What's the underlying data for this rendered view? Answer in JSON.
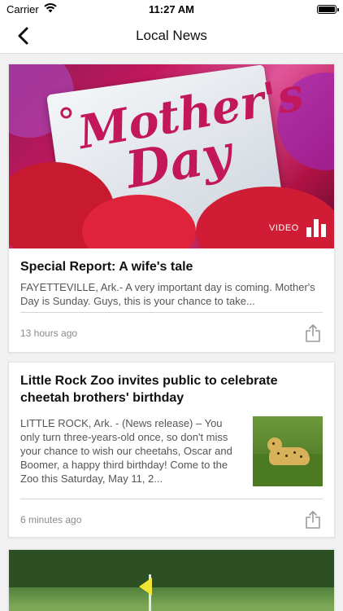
{
  "status_bar": {
    "carrier": "Carrier",
    "time": "11:27 AM",
    "battery_level": 1.0
  },
  "nav": {
    "title": "Local News",
    "back_icon": "chevron-left-icon"
  },
  "articles": [
    {
      "title": "Special Report: A wife's tale",
      "description": "FAYETTEVILLE, Ark.- A very important day is coming. Mother's Day is Sunday. Guys, this is your chance to take...",
      "time": "13 hours ago",
      "media_label": "VIDEO",
      "hero_text_line1": "Mother's",
      "hero_text_line2": "Day",
      "share_icon": "share-icon"
    },
    {
      "title": "Little Rock Zoo invites public to celebrate cheetah brothers' birthday",
      "description": "LITTLE ROCK, Ark. - (News release) – You only turn three-years-old once, so don't miss your chance to wish our cheetahs, Oscar and Boomer, a happy third birthday! Come to the Zoo this Saturday, May 11, 2...",
      "time": "6 minutes ago",
      "thumbnail": "cheetah-photo",
      "share_icon": "share-icon"
    },
    {
      "thumbnail": "golf-course-photo"
    }
  ],
  "colors": {
    "accent": "#c2185b",
    "background": "#f1f1f1",
    "meta_text": "#8a8a8a"
  }
}
